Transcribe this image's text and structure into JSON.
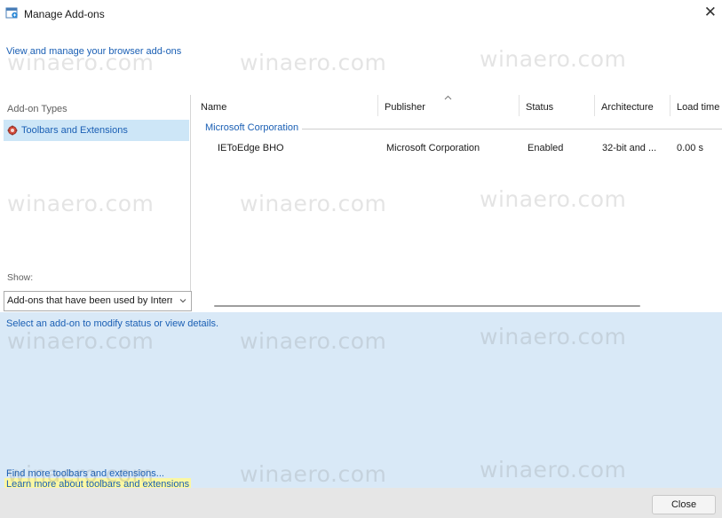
{
  "window": {
    "title": "Manage Add-ons",
    "close_glyph": "✕"
  },
  "header": {
    "link_text": "View and manage your browser add-ons"
  },
  "addon_types": {
    "header": "Add-on Types",
    "items": [
      {
        "label": "Toolbars and Extensions",
        "selected": true
      }
    ],
    "show_label": "Show:",
    "show_value": "Add-ons that have been used by Internet Explorer"
  },
  "list": {
    "columns": [
      "Name",
      "Publisher",
      "Status",
      "Architecture",
      "Load time"
    ],
    "group": "Microsoft Corporation",
    "rows": [
      {
        "name": "IEToEdge BHO",
        "publisher": "Microsoft Corporation",
        "status": "Enabled",
        "architecture": "32-bit and ...",
        "load_time": "0.00 s"
      }
    ]
  },
  "details": {
    "text": "Select an add-on to modify status or view details."
  },
  "footer": {
    "find_link": "Find more toolbars and extensions...",
    "learn_link": "Learn more about toolbars and extensions",
    "close_button": "Close"
  },
  "watermark": "winaero.com",
  "colors": {
    "link_blue": "#1a5fb4",
    "selected_bg": "#cde6f7",
    "details_bg": "#d9e9f7",
    "highlight_yellow": "#fbf7a3"
  }
}
